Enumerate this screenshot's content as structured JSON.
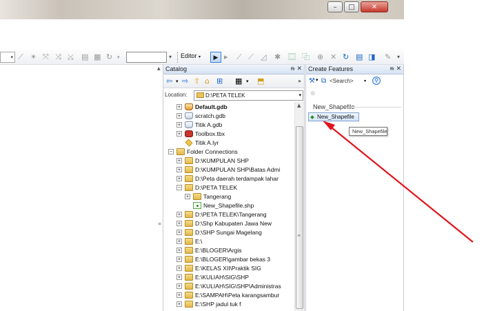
{
  "colors": {
    "accent": "#3d7bd0",
    "arrow": "#e0141a",
    "folder": "#e4b849"
  },
  "toolbar": {
    "editor_label": "Editor",
    "editor_dropdown": "▾"
  },
  "catalog": {
    "title": "Catalog",
    "pin_icon": "pin-icon",
    "close_icon": "close-icon",
    "location_label": "Location:",
    "location_value": "D:\\PETA TELEK",
    "tree": [
      {
        "label": "Default.gdb",
        "icon": "geodatabase-icon",
        "toggle": "+"
      },
      {
        "label": "scratch.gdb",
        "icon": "geodatabase-icon",
        "toggle": "+"
      },
      {
        "label": "Titik A.gdb",
        "icon": "geodatabase-icon",
        "toggle": "+"
      },
      {
        "label": "Toolbox.tbx",
        "icon": "toolbox-icon",
        "toggle": "+"
      },
      {
        "label": "Titik A.lyr",
        "icon": "layer-file-icon",
        "toggle": ""
      },
      {
        "label": "Folder Connections",
        "icon": "folder-connections-icon",
        "toggle": "−"
      },
      {
        "label": "D:\\KUMPULAN SHP",
        "icon": "folder-icon",
        "toggle": "+"
      },
      {
        "label": "D:\\KUMPULAN SHP\\Batas Admi",
        "icon": "folder-icon",
        "toggle": "+"
      },
      {
        "label": "D:\\Peta daerah terdampak lahar",
        "icon": "folder-icon",
        "toggle": "+"
      },
      {
        "label": "D:\\PETA TELEK",
        "icon": "folder-icon",
        "toggle": "−"
      },
      {
        "label": "Tangerang",
        "icon": "folder-icon",
        "toggle": "+"
      },
      {
        "label": "New_Shapefile.shp",
        "icon": "shapefile-icon",
        "toggle": ""
      },
      {
        "label": "D:\\PETA TELEK\\Tangerang",
        "icon": "folder-icon",
        "toggle": "+"
      },
      {
        "label": "D:\\Shp Kabupaten Jawa New",
        "icon": "folder-icon",
        "toggle": "+"
      },
      {
        "label": "D:\\SHP Sungai Magelang",
        "icon": "folder-icon",
        "toggle": "+"
      },
      {
        "label": "E:\\",
        "icon": "folder-icon",
        "toggle": "+"
      },
      {
        "label": "E:\\BLOGER\\Argis",
        "icon": "folder-icon",
        "toggle": "+"
      },
      {
        "label": "E:\\BLOGER\\gambar bekas 3",
        "icon": "folder-icon",
        "toggle": "+"
      },
      {
        "label": "E:\\KELAS XII\\Praktik SIG",
        "icon": "folder-icon",
        "toggle": "+"
      },
      {
        "label": "E:\\KULIAH\\SIG\\SHP",
        "icon": "folder-icon",
        "toggle": "+"
      },
      {
        "label": "E:\\KULIAH\\SIG\\SHP\\Administras",
        "icon": "folder-icon",
        "toggle": "+"
      },
      {
        "label": "E:\\SAMPAH\\Peta karangsambur",
        "icon": "folder-icon",
        "toggle": "+"
      },
      {
        "label": "E:\\SHP jadul tuk f",
        "icon": "folder-icon",
        "toggle": "+"
      }
    ]
  },
  "create_features": {
    "title": "Create Features",
    "search_placeholder": "<Search>",
    "group_label": "New_Shapefile",
    "template_label": "New_Shapefile",
    "tooltip": "New_Shapefile"
  }
}
